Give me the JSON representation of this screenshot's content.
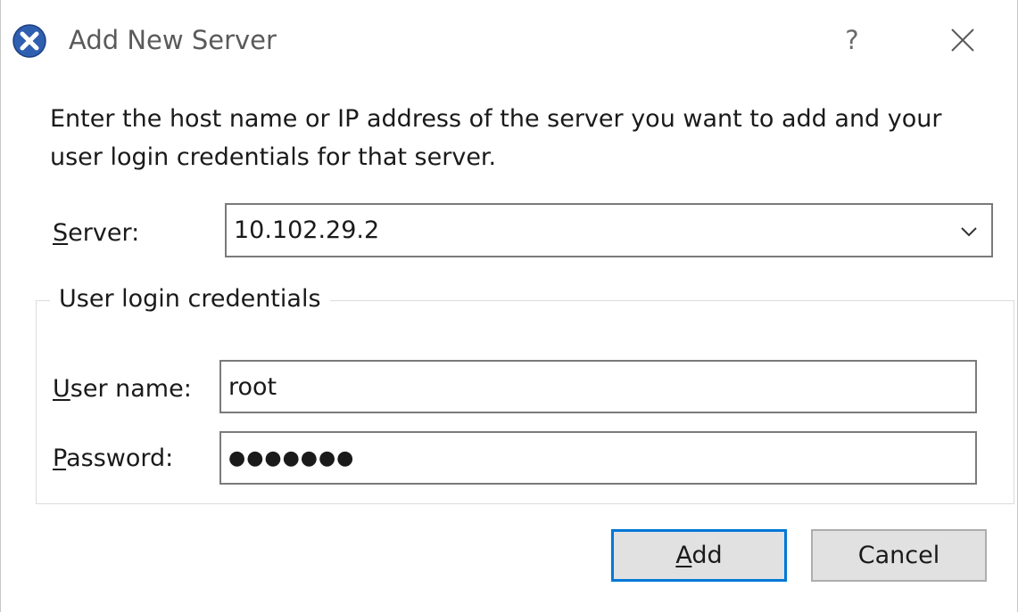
{
  "window": {
    "title": "Add New Server",
    "help_label": "?",
    "icon": "xencenter-x-icon",
    "accent_color": "#2f5fb0"
  },
  "instruction": "Enter the host name or IP address of the server you want to add and your user login credentials for that server.",
  "server": {
    "label_mnemonic": "S",
    "label_rest": "erver:",
    "value": "10.102.29.2"
  },
  "credentials": {
    "group_label": "User login credentials",
    "username_mnemonic": "U",
    "username_rest": "ser name:",
    "username_value": "root",
    "password_mnemonic": "P",
    "password_rest": "assword:",
    "password_value": "●●●●●●●"
  },
  "buttons": {
    "add_mnemonic": "A",
    "add_rest": "dd",
    "cancel_label": "Cancel"
  },
  "colors": {
    "focus_border": "#0078d7",
    "button_bg": "#e1e1e1"
  }
}
